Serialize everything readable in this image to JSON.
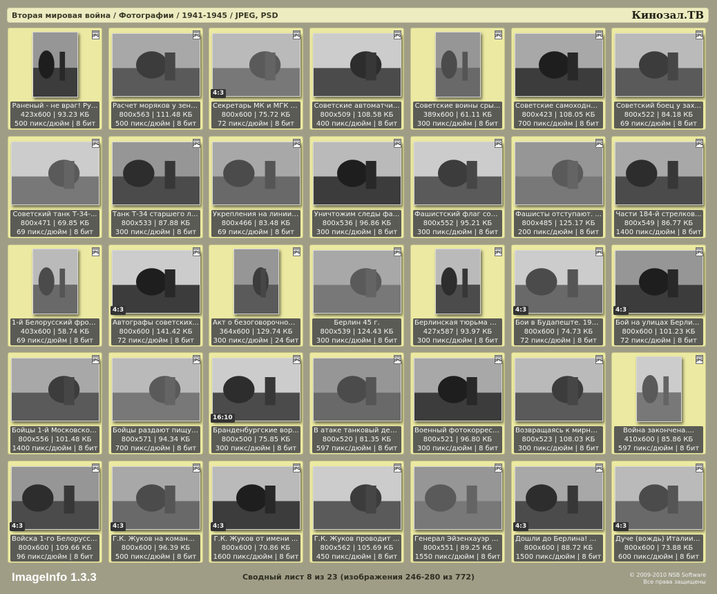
{
  "header": {
    "title": "Вторая мировая война / Фотографии / 1941-1945 / JPEG, PSD",
    "brand": "Кинозал.ТВ"
  },
  "footer": {
    "app_name": "ImageInfo 1.3.3",
    "summary": "Сводный лист 8 из 23 (изображения 246-280 из 772)",
    "copyright_line1": "© 2009-2010 NSB Software",
    "copyright_line2": "Все права защищены"
  },
  "badge_label": "JPG",
  "items": [
    {
      "title": "Раненый - не враг! Ру...",
      "dims": "423x600 | 93.23 КБ",
      "dpi": "500 пикс/дюйм | 8 бит",
      "ratio": "",
      "orient": "portrait"
    },
    {
      "title": "Расчет моряков у зени...",
      "dims": "800x563 | 111.48 КБ",
      "dpi": "500 пикс/дюйм | 8 бит",
      "ratio": "",
      "orient": "landscape"
    },
    {
      "title": "Секретарь МК и МГК В...",
      "dims": "800x600 | 75.72 КБ",
      "dpi": "72 пикс/дюйм | 8 бит",
      "ratio": "4:3",
      "orient": "landscape"
    },
    {
      "title": "Советские автоматчи...",
      "dims": "800x509 | 108.58 КБ",
      "dpi": "400 пикс/дюйм | 8 бит",
      "ratio": "",
      "orient": "landscape"
    },
    {
      "title": "Советские воины сры...",
      "dims": "389x600 | 61.11 КБ",
      "dpi": "300 пикс/дюйм | 8 бит",
      "ratio": "",
      "orient": "portrait"
    },
    {
      "title": "Советские самоходны...",
      "dims": "800x423 | 108.05 КБ",
      "dpi": "700 пикс/дюйм | 8 бит",
      "ratio": "",
      "orient": "landscape"
    },
    {
      "title": "Советский боец у зах...",
      "dims": "800x522 | 84.18 КБ",
      "dpi": "69 пикс/дюйм | 8 бит",
      "ratio": "",
      "orient": "landscape"
    },
    {
      "title": "Советский танк Т-34-...",
      "dims": "800x471 | 69.85 КБ",
      "dpi": "69 пикс/дюйм | 8 бит",
      "ratio": "",
      "orient": "landscape"
    },
    {
      "title": "Танк Т-34 старшего ле...",
      "dims": "800x533 | 87.88 КБ",
      "dpi": "300 пикс/дюйм | 8 бит",
      "ratio": "",
      "orient": "landscape"
    },
    {
      "title": "Укрепления на линии ...",
      "dims": "800x466 | 83.48 КБ",
      "dpi": "69 пикс/дюйм | 8 бит",
      "ratio": "",
      "orient": "landscape"
    },
    {
      "title": "Уничтожим следы фа...",
      "dims": "800x536 | 96.86 КБ",
      "dpi": "300 пикс/дюйм | 8 бит",
      "ratio": "",
      "orient": "landscape"
    },
    {
      "title": "Фашистский флаг сор...",
      "dims": "800x552 | 95.21 КБ",
      "dpi": "300 пикс/дюйм | 8 бит",
      "ratio": "",
      "orient": "landscape"
    },
    {
      "title": "Фашисты отступают. ...",
      "dims": "800x485 | 125.17 КБ",
      "dpi": "200 пикс/дюйм | 8 бит",
      "ratio": "",
      "orient": "landscape"
    },
    {
      "title": "Части 184-й стрелков...",
      "dims": "800x549 | 86.77 КБ",
      "dpi": "1400 пикс/дюйм | 8 бит",
      "ratio": "",
      "orient": "landscape"
    },
    {
      "title": "1-й Белорусский фрон...",
      "dims": "403x600 | 58.74 КБ",
      "dpi": "69 пикс/дюйм | 8 бит",
      "ratio": "",
      "orient": "portrait"
    },
    {
      "title": "Автографы советских...",
      "dims": "800x600 | 141.42 КБ",
      "dpi": "72 пикс/дюйм | 8 бит",
      "ratio": "4:3",
      "orient": "landscape"
    },
    {
      "title": "Акт о безоговорочной...",
      "dims": "364x600 | 129.74 КБ",
      "dpi": "300 пикс/дюйм | 24 бит",
      "ratio": "",
      "orient": "portrait"
    },
    {
      "title": "Берлин 45 г.",
      "dims": "800x539 | 124.43 КБ",
      "dpi": "300 пикс/дюйм | 8 бит",
      "ratio": "",
      "orient": "landscape"
    },
    {
      "title": "Берлинская тюрьма М...",
      "dims": "427x587 | 93.97 КБ",
      "dpi": "300 пикс/дюйм | 8 бит",
      "ratio": "",
      "orient": "portrait"
    },
    {
      "title": "Бои в Будапеште. 194...",
      "dims": "800x600 | 74.73 КБ",
      "dpi": "72 пикс/дюйм | 8 бит",
      "ratio": "4:3",
      "orient": "landscape"
    },
    {
      "title": "Бой на улицах Берлин...",
      "dims": "800x600 | 101.23 КБ",
      "dpi": "72 пикс/дюйм | 8 бит",
      "ratio": "4:3",
      "orient": "landscape"
    },
    {
      "title": "Бойцы 1-й Московской...",
      "dims": "800x556 | 101.48 КБ",
      "dpi": "1400 пикс/дюйм | 8 бит",
      "ratio": "",
      "orient": "landscape"
    },
    {
      "title": "Бойцы раздают пищу ...",
      "dims": "800x571 | 94.34 КБ",
      "dpi": "700 пикс/дюйм | 8 бит",
      "ratio": "",
      "orient": "landscape"
    },
    {
      "title": "Бранденбургские вор...",
      "dims": "800x500 | 75.85 КБ",
      "dpi": "300 пикс/дюйм | 8 бит",
      "ratio": "16:10",
      "orient": "landscape"
    },
    {
      "title": "В атаке танковый дес...",
      "dims": "800x520 | 81.35 КБ",
      "dpi": "597 пикс/дюйм | 8 бит",
      "ratio": "",
      "orient": "landscape"
    },
    {
      "title": "Военный фотокорресп...",
      "dims": "800x521 | 96.80 КБ",
      "dpi": "300 пикс/дюйм | 8 бит",
      "ratio": "",
      "orient": "landscape"
    },
    {
      "title": "Возвращаясь к мирной...",
      "dims": "800x523 | 108.03 КБ",
      "dpi": "300 пикс/дюйм | 8 бит",
      "ratio": "",
      "orient": "landscape"
    },
    {
      "title": "Война закончена....",
      "dims": "410x600 | 85.86 КБ",
      "dpi": "597 пикс/дюйм | 8 бит",
      "ratio": "",
      "orient": "portrait"
    },
    {
      "title": "Войска 1-го Белорусск...",
      "dims": "800x600 | 109.66 КБ",
      "dpi": "96 пикс/дюйм | 8 бит",
      "ratio": "4:3",
      "orient": "landscape"
    },
    {
      "title": "Г.К. Жуков на команд...",
      "dims": "800x600 | 96.39 КБ",
      "dpi": "500 пикс/дюйм | 8 бит",
      "ratio": "4:3",
      "orient": "landscape"
    },
    {
      "title": "Г.К. Жуков от имени ...",
      "dims": "800x600 | 70.86 КБ",
      "dpi": "1600 пикс/дюйм | 8 бит",
      "ratio": "4:3",
      "orient": "landscape"
    },
    {
      "title": "Г.К. Жуков проводит ...",
      "dims": "800x562 | 105.69 КБ",
      "dpi": "450 пикс/дюйм | 8 бит",
      "ratio": "",
      "orient": "landscape"
    },
    {
      "title": "Генерал Эйзенхауэр п...",
      "dims": "800x551 | 89.25 КБ",
      "dpi": "1550 пикс/дюйм | 8 бит",
      "ratio": "",
      "orient": "landscape"
    },
    {
      "title": "Дошли до Берлина! М...",
      "dims": "800x600 | 88.72 КБ",
      "dpi": "1500 пикс/дюйм | 8 бит",
      "ratio": "4:3",
      "orient": "landscape"
    },
    {
      "title": "Дуче (вождь) Италии ...",
      "dims": "800x600 | 73.88 КБ",
      "dpi": "600 пикс/дюйм | 8 бит",
      "ratio": "4:3",
      "orient": "landscape"
    }
  ]
}
